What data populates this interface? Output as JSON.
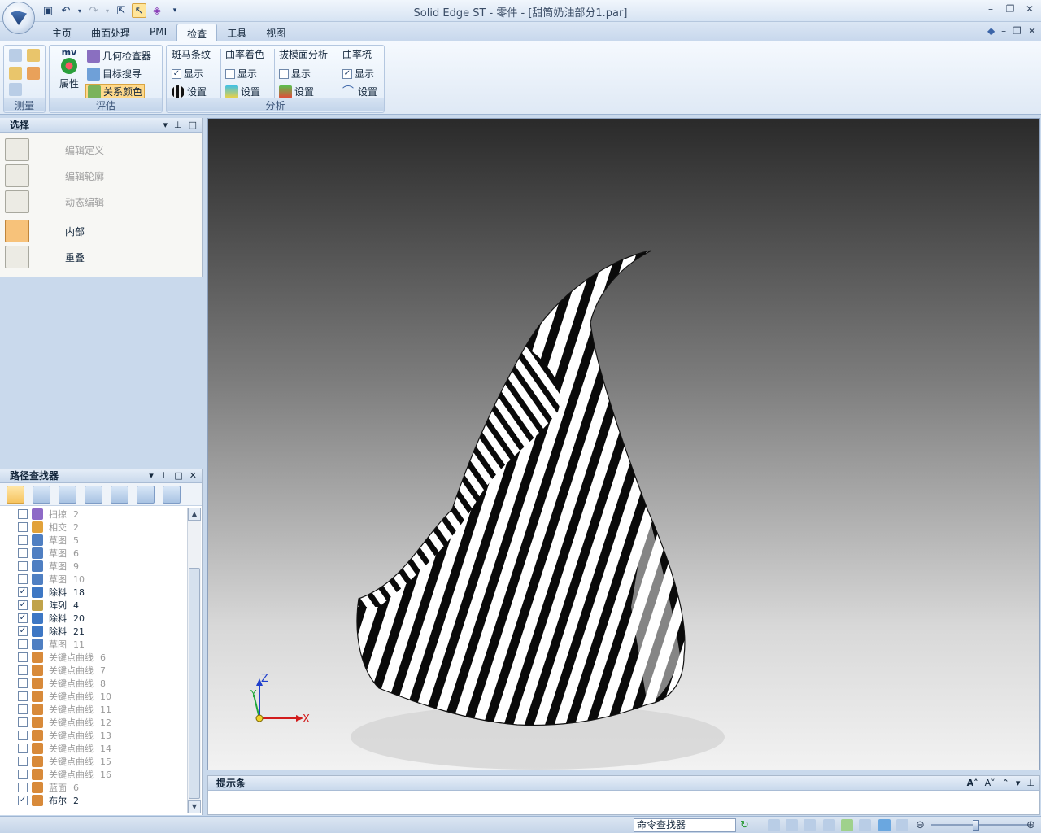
{
  "window": {
    "title": "Solid Edge ST - 零件 - [甜筒奶油部分1.par]"
  },
  "quick_access": [
    "save-icon",
    "undo-icon",
    "redo-icon",
    "help-select-icon",
    "select-icon",
    "part-icon",
    "more-icon"
  ],
  "tabs": [
    {
      "label": "主页"
    },
    {
      "label": "曲面处理"
    },
    {
      "label": "PMI"
    },
    {
      "label": "检查",
      "active": true
    },
    {
      "label": "工具"
    },
    {
      "label": "视图"
    }
  ],
  "ribbon": {
    "measure": {
      "label": "测量"
    },
    "evaluate": {
      "label": "评估",
      "mv": "mv",
      "properties": "属性",
      "geometry_inspector": "几何检查器",
      "target_search": "目标搜寻",
      "relation_colors": "关系颜色"
    },
    "analysis": {
      "label": "分析",
      "zebra": {
        "title": "斑马条纹",
        "show": "显示",
        "settings": "设置",
        "checked": true
      },
      "curvature_shading": {
        "title": "曲率着色",
        "show": "显示",
        "settings": "设置",
        "checked": false
      },
      "draft_analysis": {
        "title": "拔模面分析",
        "show": "显示",
        "settings": "设置",
        "checked": false
      },
      "curvature_comb": {
        "title": "曲率梳",
        "show": "显示",
        "settings": "设置",
        "checked": true
      }
    }
  },
  "select_panel": {
    "title": "选择",
    "items": [
      {
        "label": "编辑定义",
        "enabled": false
      },
      {
        "label": "编辑轮廓",
        "enabled": false
      },
      {
        "label": "动态编辑",
        "enabled": false
      },
      {
        "label": "内部",
        "enabled": true
      },
      {
        "label": "重叠",
        "enabled": true
      }
    ]
  },
  "pathfinder": {
    "title": "路径查找器",
    "items": [
      {
        "label": "扫掠",
        "num": "2",
        "checked": false
      },
      {
        "label": "相交",
        "num": "2",
        "checked": false
      },
      {
        "label": "草图",
        "num": "5",
        "checked": false
      },
      {
        "label": "草图",
        "num": "6",
        "checked": false
      },
      {
        "label": "草图",
        "num": "9",
        "checked": false
      },
      {
        "label": "草图",
        "num": "10",
        "checked": false
      },
      {
        "label": "除料",
        "num": "18",
        "checked": true
      },
      {
        "label": "阵列",
        "num": "4",
        "checked": true
      },
      {
        "label": "除料",
        "num": "20",
        "checked": true
      },
      {
        "label": "除料",
        "num": "21",
        "checked": true
      },
      {
        "label": "草图",
        "num": "11",
        "checked": false
      },
      {
        "label": "关键点曲线",
        "num": "6",
        "checked": false
      },
      {
        "label": "关键点曲线",
        "num": "7",
        "checked": false
      },
      {
        "label": "关键点曲线",
        "num": "8",
        "checked": false
      },
      {
        "label": "关键点曲线",
        "num": "10",
        "checked": false
      },
      {
        "label": "关键点曲线",
        "num": "11",
        "checked": false
      },
      {
        "label": "关键点曲线",
        "num": "12",
        "checked": false
      },
      {
        "label": "关键点曲线",
        "num": "13",
        "checked": false
      },
      {
        "label": "关键点曲线",
        "num": "14",
        "checked": false
      },
      {
        "label": "关键点曲线",
        "num": "15",
        "checked": false
      },
      {
        "label": "关键点曲线",
        "num": "16",
        "checked": false
      },
      {
        "label": "蓝面",
        "num": "6",
        "checked": false
      },
      {
        "label": "布尔",
        "num": "2",
        "checked": true
      }
    ]
  },
  "viewport": {
    "axes": {
      "z": "Z",
      "y": "Y",
      "x": "X"
    }
  },
  "prompt_bar": {
    "title": "提示条"
  },
  "status": {
    "command_finder": "命令查找器"
  }
}
